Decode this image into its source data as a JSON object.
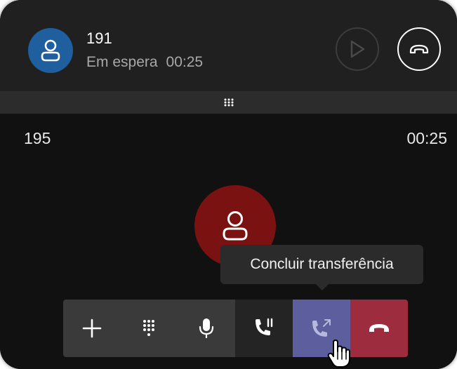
{
  "held_call": {
    "number": "191",
    "status": "Em espera",
    "timer": "00:25"
  },
  "active_call": {
    "number": "195",
    "timer": "00:25"
  },
  "tooltip": {
    "text": "Concluir transferência"
  },
  "toolbar": {
    "buttons": [
      {
        "name": "add-call",
        "icon": "plus-icon"
      },
      {
        "name": "keypad",
        "icon": "keypad-icon"
      },
      {
        "name": "mute",
        "icon": "microphone-icon"
      },
      {
        "name": "hold",
        "icon": "phone-hold-icon"
      },
      {
        "name": "complete-transfer",
        "icon": "phone-transfer-icon"
      },
      {
        "name": "hang-up",
        "icon": "phone-hangup-icon"
      }
    ]
  },
  "colors": {
    "held_avatar": "#1f5f9e",
    "active_avatar": "#7a1212",
    "transfer_button": "#5c5e9e",
    "hangup_button": "#9e2c3f"
  }
}
